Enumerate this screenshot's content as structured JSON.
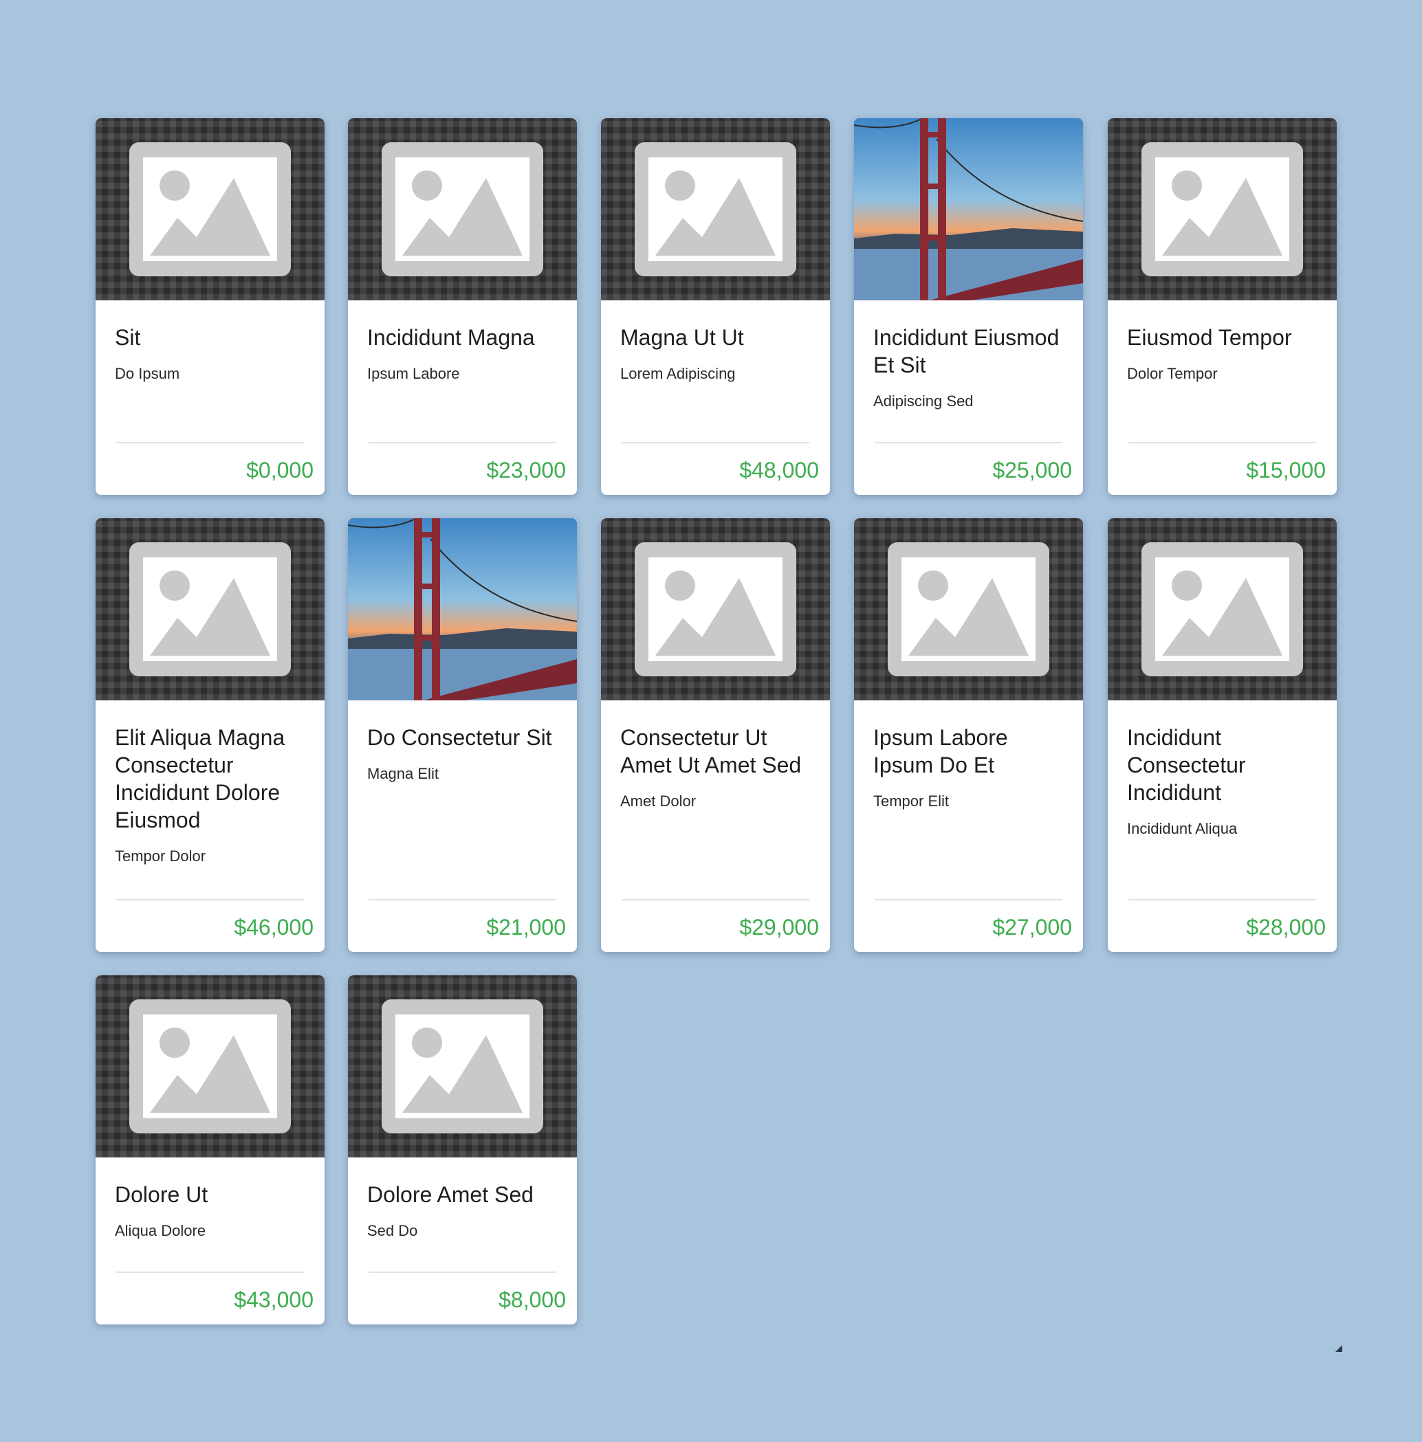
{
  "products": [
    {
      "title": "Sit",
      "subtitle": "Do Ipsum",
      "price": "$0,000",
      "image": "placeholder"
    },
    {
      "title": "Incididunt Magna",
      "subtitle": "Ipsum Labore",
      "price": "$23,000",
      "image": "placeholder"
    },
    {
      "title": "Magna Ut Ut",
      "subtitle": "Lorem Adipiscing",
      "price": "$48,000",
      "image": "placeholder"
    },
    {
      "title": "Incididunt Eiusmod Et Sit",
      "subtitle": "Adipiscing Sed",
      "price": "$25,000",
      "image": "bridge-photo"
    },
    {
      "title": "Eiusmod Tempor",
      "subtitle": "Dolor Tempor",
      "price": "$15,000",
      "image": "placeholder"
    },
    {
      "title": "Elit Aliqua Magna Consectetur Incididunt Dolore Eiusmod",
      "subtitle": "Tempor Dolor",
      "price": "$46,000",
      "image": "placeholder"
    },
    {
      "title": "Do Consectetur Sit",
      "subtitle": "Magna Elit",
      "price": "$21,000",
      "image": "bridge-photo"
    },
    {
      "title": "Consectetur Ut Amet Ut Amet Sed",
      "subtitle": "Amet Dolor",
      "price": "$29,000",
      "image": "placeholder"
    },
    {
      "title": "Ipsum Labore Ipsum Do Et",
      "subtitle": "Tempor Elit",
      "price": "$27,000",
      "image": "placeholder"
    },
    {
      "title": "Incididunt Consectetur Incididunt",
      "subtitle": "Incididunt Aliqua",
      "price": "$28,000",
      "image": "placeholder"
    },
    {
      "title": "Dolore Ut",
      "subtitle": "Aliqua Dolore",
      "price": "$43,000",
      "image": "placeholder"
    },
    {
      "title": "Dolore Amet Sed",
      "subtitle": "Sed Do",
      "price": "$8,000",
      "image": "placeholder"
    }
  ],
  "colors": {
    "background": "#a9c4dd",
    "price": "#3dad4f",
    "card": "#ffffff"
  }
}
